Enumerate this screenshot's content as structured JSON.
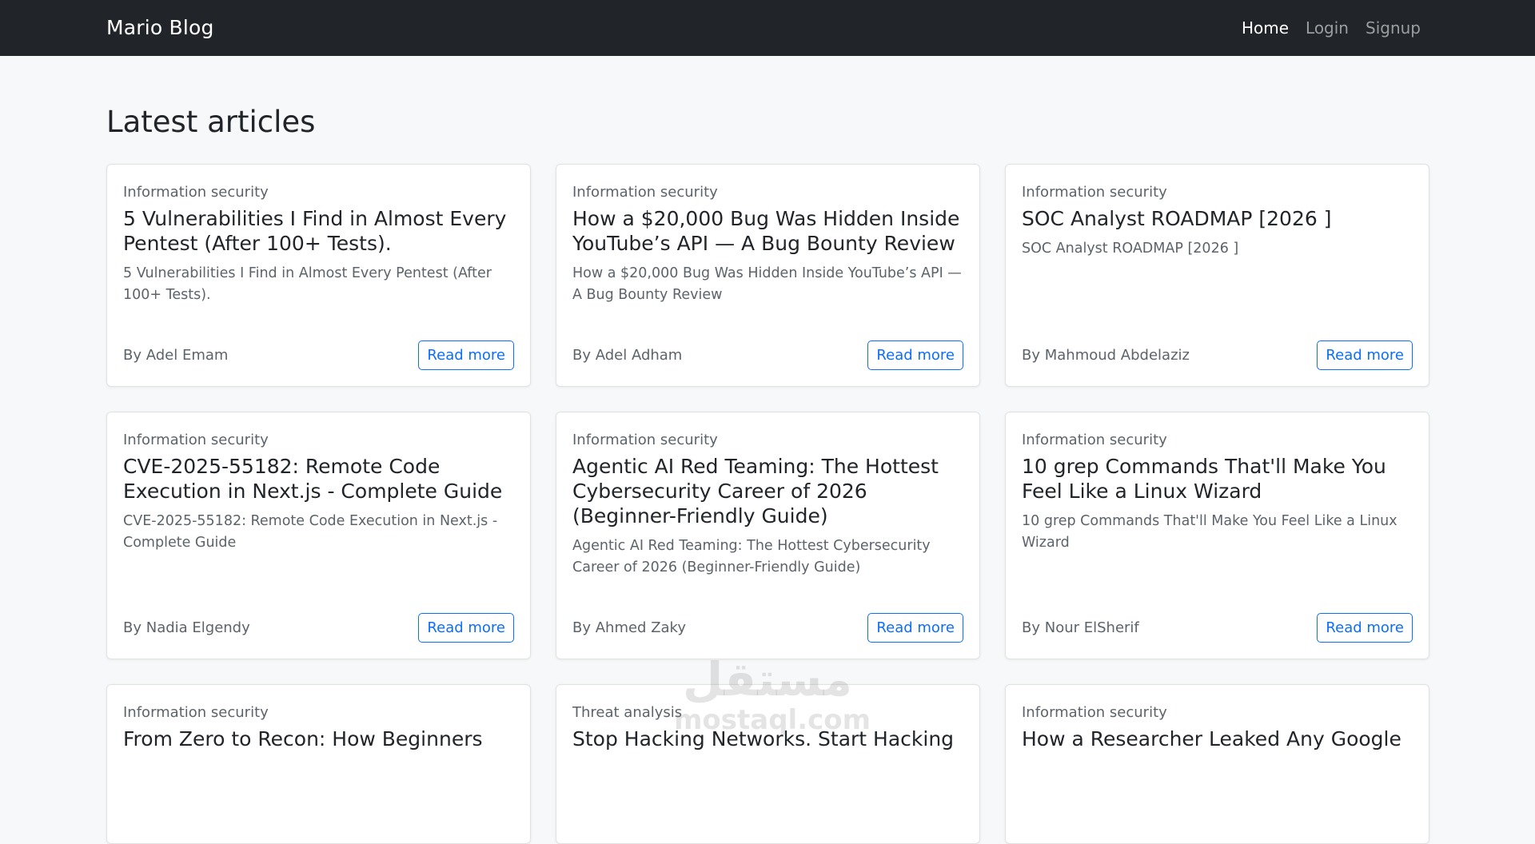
{
  "navbar": {
    "brand": "Mario Blog",
    "links": [
      {
        "label": "Home"
      },
      {
        "label": "Login"
      },
      {
        "label": "Signup"
      }
    ]
  },
  "page": {
    "title": "Latest articles"
  },
  "articles": [
    {
      "category": "Information security",
      "title": "5 Vulnerabilities I Find in Almost Every Pentest (After 100+ Tests).",
      "summary": "5 Vulnerabilities I Find in Almost Every Pentest (After 100+ Tests).",
      "author": "By Adel Emam",
      "button": "Read more"
    },
    {
      "category": "Information security",
      "title": "How a $20,000 Bug Was Hidden Inside YouTube’s API — A Bug Bounty Review",
      "summary": "How a $20,000 Bug Was Hidden Inside YouTube’s API — A Bug Bounty Review",
      "author": "By Adel Adham",
      "button": "Read more"
    },
    {
      "category": "Information security",
      "title": "SOC Analyst ROADMAP [2026 ]",
      "summary": "SOC Analyst ROADMAP [2026 ]",
      "author": "By Mahmoud Abdelaziz",
      "button": "Read more"
    },
    {
      "category": "Information security",
      "title": "CVE-2025-55182: Remote Code Execution in Next.js - Complete Guide",
      "summary": "CVE-2025-55182: Remote Code Execution in Next.js - Complete Guide",
      "author": "By Nadia Elgendy",
      "button": "Read more"
    },
    {
      "category": "Information security",
      "title": "Agentic AI Red Teaming: The Hottest Cybersecurity Career of 2026 (Beginner-Friendly Guide)",
      "summary": "Agentic AI Red Teaming: The Hottest Cybersecurity Career of 2026 (Beginner-Friendly Guide)",
      "author": "By Ahmed Zaky",
      "button": "Read more"
    },
    {
      "category": "Information security",
      "title": "10 grep Commands That'll Make You Feel Like a Linux Wizard",
      "summary": "10 grep Commands That'll Make You Feel Like a Linux Wizard",
      "author": "By Nour ElSherif",
      "button": "Read more"
    },
    {
      "category": "Information security",
      "title": "From Zero to Recon: How Beginners",
      "summary": "",
      "author": "",
      "button": ""
    },
    {
      "category": "Threat analysis",
      "title": "Stop Hacking Networks. Start Hacking",
      "summary": "",
      "author": "",
      "button": ""
    },
    {
      "category": "Information security",
      "title": "How a Researcher Leaked Any Google",
      "summary": "",
      "author": "",
      "button": ""
    }
  ],
  "watermark": {
    "arabic": "مستقل",
    "latin": "mostaql.com"
  }
}
